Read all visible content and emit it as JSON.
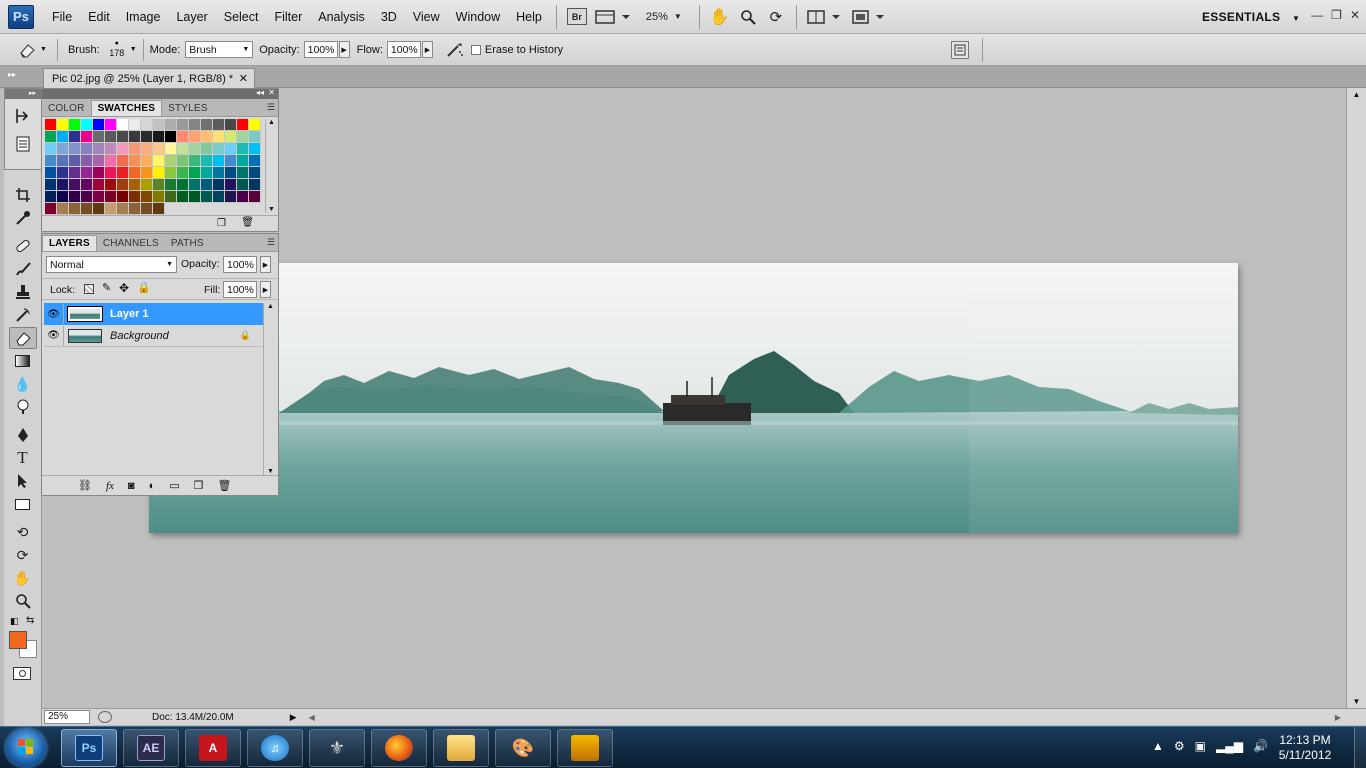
{
  "app": {
    "logo": "Ps",
    "menu": [
      "File",
      "Edit",
      "Image",
      "Layer",
      "Select",
      "Filter",
      "Analysis",
      "3D",
      "View",
      "Window",
      "Help"
    ],
    "bridge_label": "Br",
    "zoom_label": "25%",
    "workspace": "ESSENTIALS"
  },
  "options": {
    "brush_label": "Brush:",
    "brush_size": "178",
    "mode_label": "Mode:",
    "mode_value": "Brush",
    "opacity_label": "Opacity:",
    "opacity_value": "100%",
    "flow_label": "Flow:",
    "flow_value": "100%",
    "erase_history_label": "Erase to History"
  },
  "document": {
    "tab_title": "Pic 02.jpg @ 25% (Layer 1, RGB/8) *",
    "zoom": "25%",
    "doc_info": "Doc: 13.4M/20.0M"
  },
  "swatches_panel": {
    "tabs": [
      "COLOR",
      "SWATCHES",
      "STYLES"
    ],
    "active_tab": "SWATCHES",
    "colors": [
      "#ff0000",
      "#ffff00",
      "#00ff00",
      "#00ffff",
      "#0000ff",
      "#ff00ff",
      "#ffffff",
      "#ebebeb",
      "#d6d6d6",
      "#c2c2c2",
      "#adadad",
      "#999999",
      "#858585",
      "#707070",
      "#5c5c5c",
      "#474747",
      "#ff0000",
      "#ffff00",
      "#00a651",
      "#00aeef",
      "#2e3192",
      "#ec008c",
      "#6b6b6b",
      "#5a5a5a",
      "#4a4a4a",
      "#3a3a3a",
      "#2a2a2a",
      "#1a1a1a",
      "#000000",
      "#ff8a70",
      "#ffa070",
      "#ffbe70",
      "#ffe070",
      "#d7e86f",
      "#a2d39c",
      "#7dcbc0",
      "#6dcff6",
      "#7da7d9",
      "#8393ca",
      "#8781bd",
      "#a187be",
      "#bd8cbf",
      "#f49ac1",
      "#f7977a",
      "#f9ad81",
      "#fdc68a",
      "#fff79a",
      "#c4df9b",
      "#a3d39c",
      "#82ca9c",
      "#7accc8",
      "#6ecff6",
      "#1cbbb4",
      "#00bff3",
      "#448ccb",
      "#5574b9",
      "#605ca8",
      "#8560a8",
      "#a864a8",
      "#f06eaa",
      "#f26c4f",
      "#f68e56",
      "#fbaf5d",
      "#fff568",
      "#acd373",
      "#7cc576",
      "#3bb878",
      "#1abbb4",
      "#00bff3",
      "#448ccb",
      "#00a99d",
      "#0072bc",
      "#0054a6",
      "#2e3192",
      "#662d91",
      "#92278f",
      "#9e005d",
      "#ed145b",
      "#ed1c24",
      "#f26522",
      "#f7941d",
      "#fff200",
      "#8dc63f",
      "#39b54a",
      "#00a651",
      "#00a99d",
      "#0076a3",
      "#004b80",
      "#00746b",
      "#004a80",
      "#003471",
      "#1b1464",
      "#440e62",
      "#630460",
      "#9e0039",
      "#9e0b0f",
      "#a0410d",
      "#a36209",
      "#aba000",
      "#598527",
      "#197b30",
      "#007236",
      "#00746b",
      "#005b7f",
      "#003663",
      "#21145f",
      "#005952",
      "#003663",
      "#002157",
      "#0d004c",
      "#32004b",
      "#4b0049",
      "#7b0046",
      "#7a0026",
      "#790000",
      "#7b2e00",
      "#7d4900",
      "#827b00",
      "#406618",
      "#005e20",
      "#005826",
      "#005952",
      "#00435e",
      "#211551",
      "#4b004b",
      "#5b003c",
      "#7a002f",
      "#a67c52",
      "#8c6239",
      "#754c24",
      "#603913",
      "#c69c6d",
      "#a67c52",
      "#8c6239",
      "#754c24",
      "#603913"
    ]
  },
  "layers_panel": {
    "tabs": [
      "LAYERS",
      "CHANNELS",
      "PATHS"
    ],
    "active_tab": "LAYERS",
    "blend_mode": "Normal",
    "opacity_label": "Opacity:",
    "opacity_value": "100%",
    "lock_label": "Lock:",
    "fill_label": "Fill:",
    "fill_value": "100%",
    "layers": [
      {
        "name": "Layer 1",
        "selected": true
      },
      {
        "name": "Background",
        "selected": false,
        "locked": true
      }
    ]
  },
  "colors": {
    "foreground": "#f26a21",
    "background": "#ffffff",
    "selection": "#3399ff"
  },
  "taskbar": {
    "apps": [
      "Ps",
      "AE",
      "Acrobat",
      "iTunes",
      "Skyrim",
      "Firefox",
      "Explorer",
      "Paint",
      "Movie Maker"
    ],
    "time": "12:13 PM",
    "date": "5/11/2012"
  }
}
